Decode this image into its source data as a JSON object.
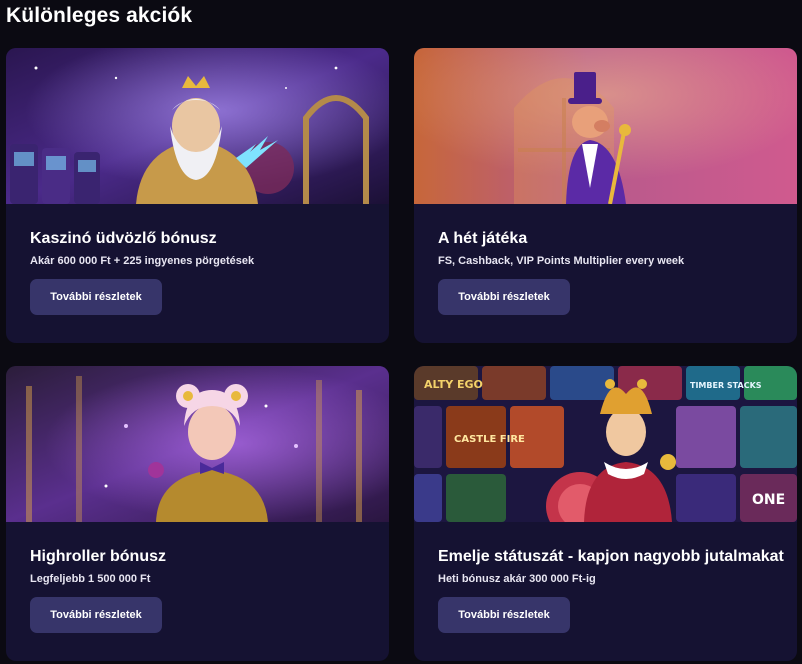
{
  "section": {
    "title": "Különleges akciók"
  },
  "promotions": [
    {
      "title": "Kaszinó üdvözlő bónusz",
      "description": "Akár 600 000 Ft + 225 ingyenes pörgetések",
      "button_label": "További részletek",
      "image": "zeus-character-illustration"
    },
    {
      "title": "A hét játéka",
      "description": "FS, Cashback, VIP Points Multiplier every week",
      "button_label": "További részletek",
      "image": "pig-in-top-hat-illustration"
    },
    {
      "title": "Highroller bónusz",
      "description": "Legfeljebb 1 500 000 Ft",
      "button_label": "További részletek",
      "image": "harley-girl-casino-illustration"
    },
    {
      "title": "Emelje státuszát - kapjon nagyobb jutalmakat",
      "description": "Heti bónusz akár 300 000 Ft-ig",
      "button_label": "További részletek",
      "image": "jester-slot-game-collage",
      "tile_labels": [
        "ALTY EGO",
        "CASTLE FIRE",
        "TIMBER STACKS",
        "ONE"
      ]
    }
  ],
  "colors": {
    "page_background": "#0b0a12",
    "card_background": "#151232",
    "button_background": "#37356a",
    "text": "#ffffff"
  }
}
